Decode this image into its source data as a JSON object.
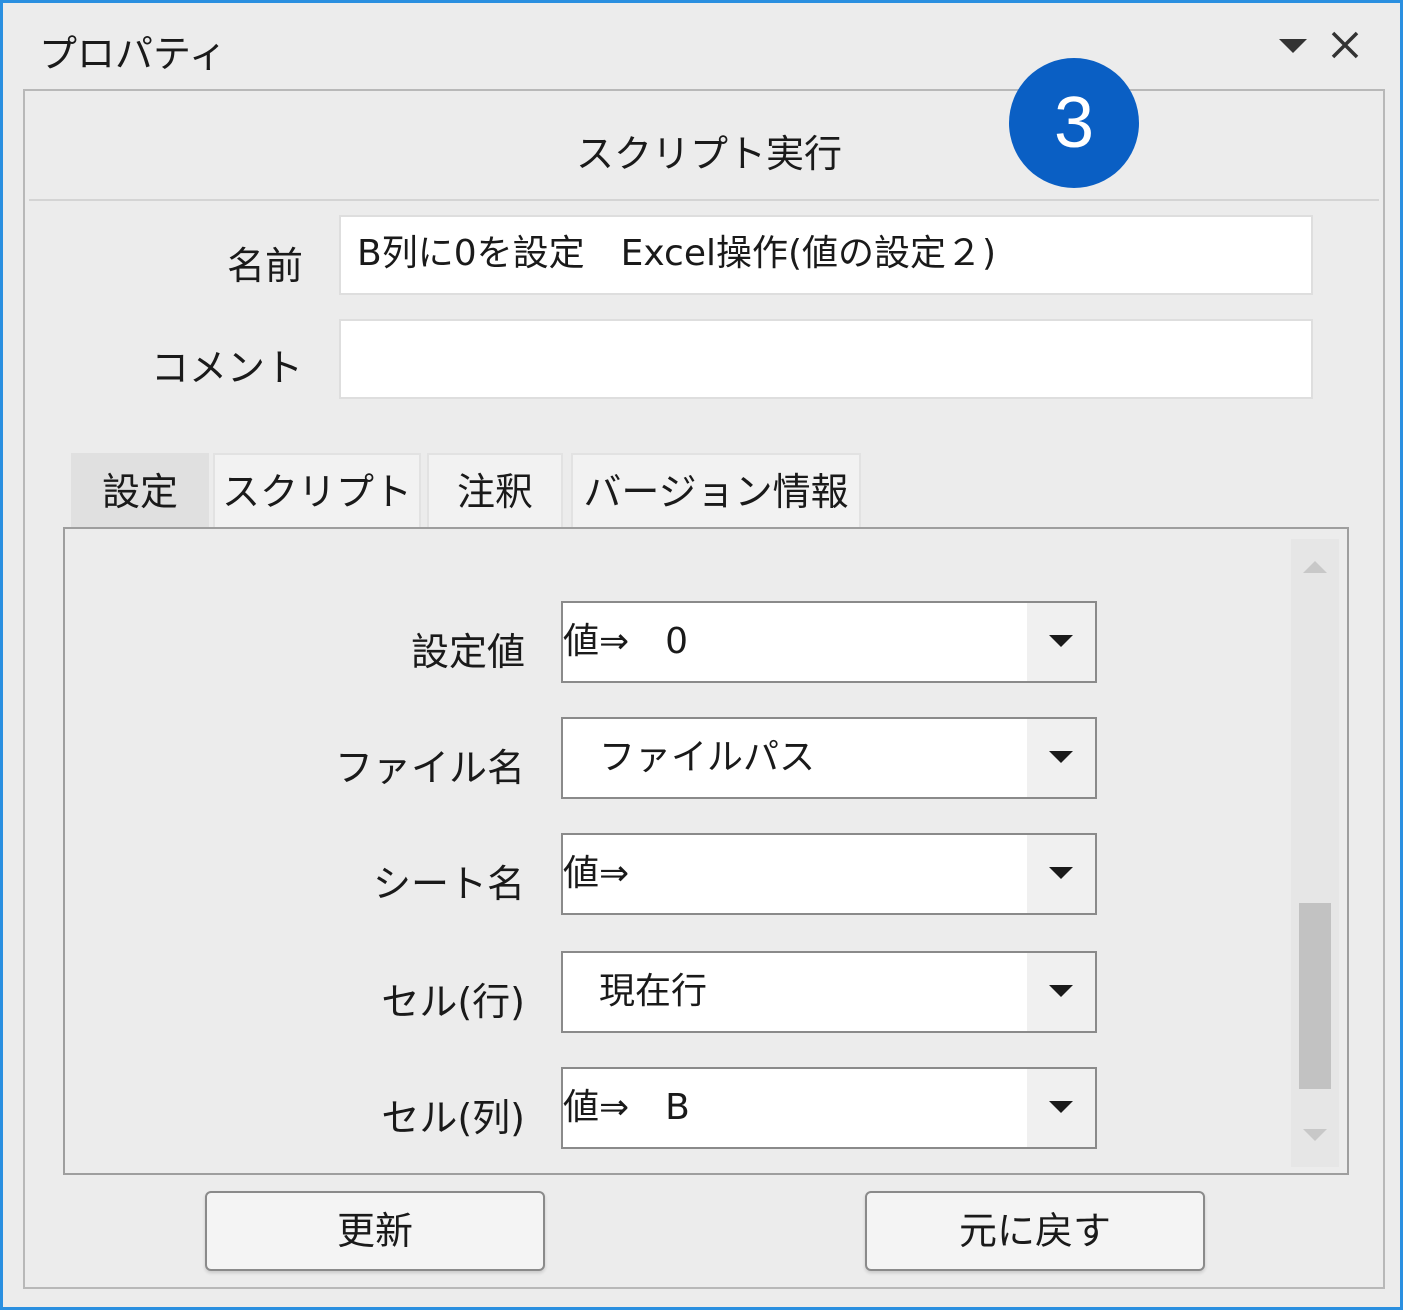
{
  "window": {
    "title": "プロパティ",
    "dropdown_icon": "triangle-down-icon",
    "close_icon": "close-icon"
  },
  "panel": {
    "title": "スクリプト実行",
    "step_badge": "3"
  },
  "fields": {
    "name_label": "名前",
    "name_value": "B列に0を設定　Excel操作(値の設定２)",
    "comment_label": "コメント",
    "comment_value": ""
  },
  "tabs": [
    {
      "label": "設定",
      "active": true
    },
    {
      "label": "スクリプト",
      "active": false
    },
    {
      "label": "注釈",
      "active": false
    },
    {
      "label": "バージョン情報",
      "active": false
    }
  ],
  "settings": [
    {
      "label": "設定値",
      "value": "値⇒　0"
    },
    {
      "label": "ファイル名",
      "value": "　ファイルパス"
    },
    {
      "label": "シート名",
      "value": "値⇒"
    },
    {
      "label": "セル(行)",
      "value": "　現在行"
    },
    {
      "label": "セル(列)",
      "value": "値⇒　B"
    }
  ],
  "buttons": {
    "update": "更新",
    "revert": "元に戻す"
  },
  "colors": {
    "accent_border": "#2a8fe0",
    "badge": "#0a5fc4"
  }
}
